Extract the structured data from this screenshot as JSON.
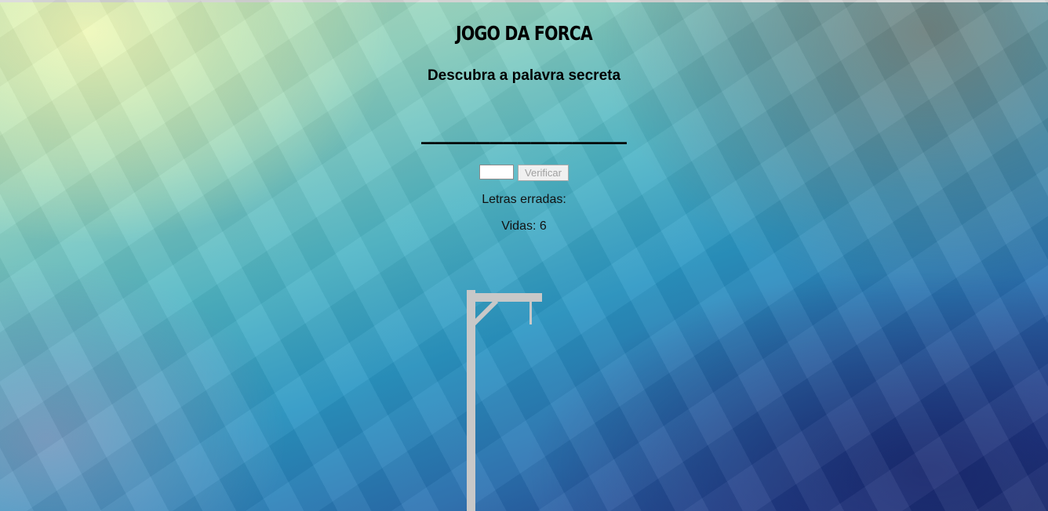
{
  "game": {
    "title": "JOGO DA FORCA",
    "subtitle": "Descubra a palavra secreta",
    "secret_word_display": "_______________",
    "wrong_letters_label": "Letras erradas:",
    "lives_label": "Vidas: 6",
    "lives": 6
  },
  "form": {
    "input_value": "",
    "verify_label": "Verificar"
  },
  "icons": {
    "gallows": "gallows-icon"
  },
  "colors": {
    "gallows": "#c8c8c8",
    "text": "#000000",
    "disabled_button_text": "#a0a0a0"
  }
}
